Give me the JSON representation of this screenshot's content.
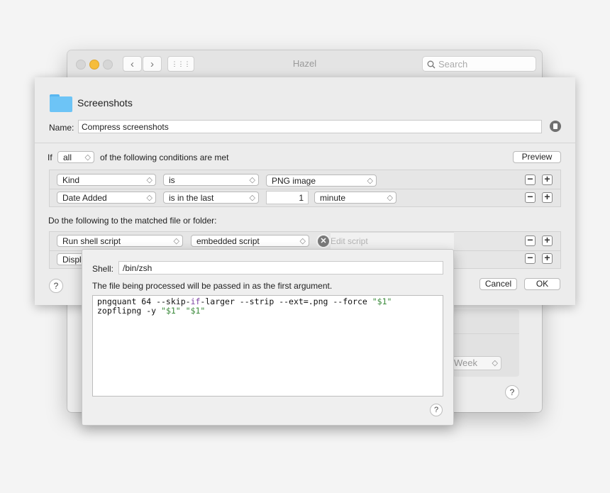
{
  "back_window": {
    "title": "Hazel",
    "search_placeholder": "Search",
    "nav_back": "‹",
    "nav_forward": "›",
    "grid_icon": "⋮⋮⋮",
    "week_value": "Week",
    "help": "?"
  },
  "sheet": {
    "folder_name": "Screenshots",
    "name_label": "Name:",
    "name_value": "Compress screenshots",
    "if_label": "If",
    "match_value": "all",
    "conditions_text": "of the following conditions are met",
    "preview_label": "Preview",
    "conditions": [
      {
        "attribute": "Kind",
        "operator": "is",
        "value": "PNG image"
      },
      {
        "attribute": "Date Added",
        "operator": "is in the last",
        "number": "1",
        "unit": "minute"
      }
    ],
    "actions_label": "Do the following to the matched file or folder:",
    "actions": [
      {
        "action": "Run shell script",
        "script_type": "embedded script",
        "edit_label": "Edit script"
      },
      {
        "action": "Displ"
      }
    ],
    "cancel_label": "Cancel",
    "ok_label": "OK",
    "help": "?",
    "minus": "−",
    "plus": "+"
  },
  "script_popover": {
    "shell_label": "Shell:",
    "shell_value": "/bin/zsh",
    "description": "The file being processed will be passed in as the first argument.",
    "script_lines": [
      "pngquant 64 --skip-if-larger --strip --ext=.png --force \"$1\"",
      "zopflipng -y \"$1\" \"$1\""
    ],
    "help": "?"
  },
  "colors": {
    "folder": "#6dc4f6",
    "keyword": "#7b3fa0",
    "string": "#3b8a3b",
    "traffic_yellow": "#f6bd3b"
  }
}
